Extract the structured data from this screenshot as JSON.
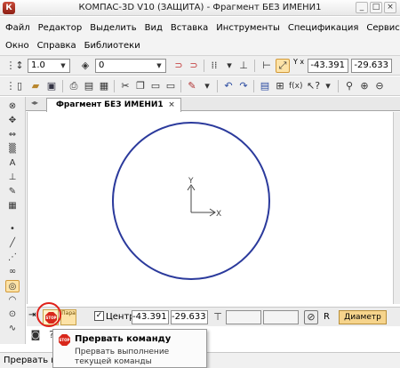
{
  "window": {
    "title": "КОМПАС-3D V10 (ЗАЩИТА) - Фрагмент БЕЗ ИМЕНИ1",
    "app_icon": "К",
    "buttons": [
      "_",
      "□",
      "×"
    ]
  },
  "menu": {
    "row1": [
      "Файл",
      "Редактор",
      "Выделить",
      "Вид",
      "Вставка",
      "Инструменты",
      "Спецификация",
      "Сервис"
    ],
    "row2": [
      "Окно",
      "Справка",
      "Библиотеки"
    ]
  },
  "toolbar1": {
    "line_scale": "1.0",
    "layer": "0",
    "coord_x_label": "Y x",
    "coord_x": "-43.391",
    "coord_y": "-29.633"
  },
  "document": {
    "tab_label": "Фрагмент БЕЗ ИМЕНИ1",
    "tab_close": "×"
  },
  "canvas": {
    "axis_x_label": "X",
    "axis_y_label": "Y"
  },
  "property_bar": {
    "stop_glyph": "STOP",
    "param_label": "Пара",
    "center_label": "Центр",
    "center_x": "-43.391",
    "center_y": "-29.633",
    "r_label": "R",
    "diameter_label": "Диаметр",
    "center_checked": "✓"
  },
  "status_bar": {
    "text": "Прервать вы"
  },
  "tooltip": {
    "title": "Прервать команду",
    "description": "Прервать выполнение текущей команды"
  },
  "colors": {
    "circle_stroke": "#2b3a9c",
    "stop_red": "#d8261a",
    "highlight_orange": "#fde3a7"
  }
}
